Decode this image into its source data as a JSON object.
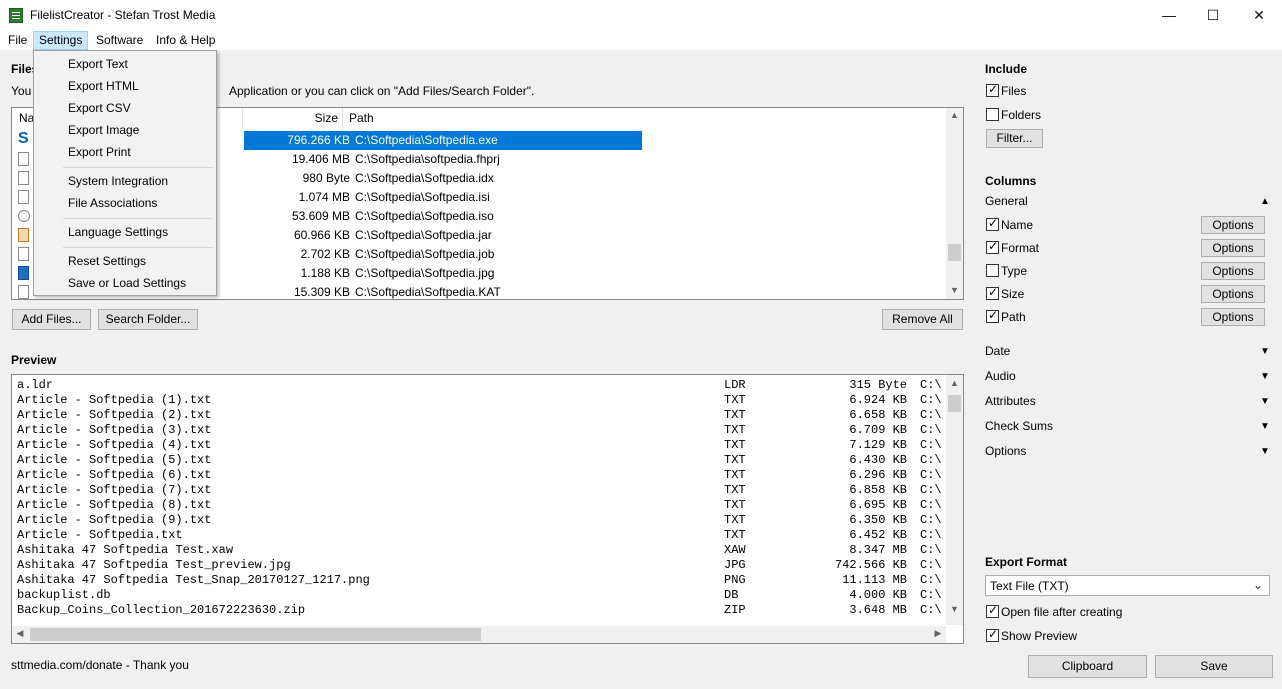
{
  "window": {
    "title": "FilelistCreator - Stefan Trost Media",
    "minimize": "—",
    "maximize": "☐",
    "close": "✕"
  },
  "menubar": [
    "File",
    "Settings",
    "Software",
    "Info & Help"
  ],
  "settings_menu": {
    "items": [
      "Export Text",
      "Export HTML",
      "Export CSV",
      "Export Image",
      "Export Print",
      "System Integration",
      "File Associations",
      "Language Settings",
      "Reset Settings",
      "Save or Load Settings"
    ]
  },
  "files_section": {
    "title": "Files",
    "hint_prefix": "You",
    "hint_suffix": "Application or you can click on \"Add Files/Search Folder\".",
    "columns": {
      "name": "Na",
      "size": "Size",
      "path": "Path"
    },
    "rows": [
      {
        "size": "796.266 KB",
        "path": "C:\\Softpedia\\Softpedia.exe",
        "selected": true
      },
      {
        "size": "19.406 MB",
        "path": "C:\\Softpedia\\softpedia.fhprj"
      },
      {
        "size": "980 Byte",
        "path": "C:\\Softpedia\\Softpedia.idx"
      },
      {
        "size": "1.074 MB",
        "path": "C:\\Softpedia\\Softpedia.isi"
      },
      {
        "size": "53.609 MB",
        "path": "C:\\Softpedia\\Softpedia.iso"
      },
      {
        "size": "60.966 KB",
        "path": "C:\\Softpedia\\Softpedia.jar"
      },
      {
        "size": "2.702 KB",
        "path": "C:\\Softpedia\\Softpedia.job"
      },
      {
        "size": "1.188 KB",
        "path": "C:\\Softpedia\\Softpedia.jpg"
      },
      {
        "size": "15.309 KB",
        "path": "C:\\Softpedia\\Softpedia.KAT"
      }
    ],
    "add_files": "Add Files...",
    "search_folder": "Search Folder...",
    "remove_all": "Remove All"
  },
  "preview": {
    "title": "Preview",
    "rows": [
      {
        "name": "a.ldr",
        "ext": "LDR",
        "size": "315 Byte",
        "path": "C:\\"
      },
      {
        "name": "Article - Softpedia (1).txt",
        "ext": "TXT",
        "size": "6.924 KB",
        "path": "C:\\"
      },
      {
        "name": "Article - Softpedia (2).txt",
        "ext": "TXT",
        "size": "6.658 KB",
        "path": "C:\\"
      },
      {
        "name": "Article - Softpedia (3).txt",
        "ext": "TXT",
        "size": "6.709 KB",
        "path": "C:\\"
      },
      {
        "name": "Article - Softpedia (4).txt",
        "ext": "TXT",
        "size": "7.129 KB",
        "path": "C:\\"
      },
      {
        "name": "Article - Softpedia (5).txt",
        "ext": "TXT",
        "size": "6.430 KB",
        "path": "C:\\"
      },
      {
        "name": "Article - Softpedia (6).txt",
        "ext": "TXT",
        "size": "6.296 KB",
        "path": "C:\\"
      },
      {
        "name": "Article - Softpedia (7).txt",
        "ext": "TXT",
        "size": "6.858 KB",
        "path": "C:\\"
      },
      {
        "name": "Article - Softpedia (8).txt",
        "ext": "TXT",
        "size": "6.695 KB",
        "path": "C:\\"
      },
      {
        "name": "Article - Softpedia (9).txt",
        "ext": "TXT",
        "size": "6.350 KB",
        "path": "C:\\"
      },
      {
        "name": "Article - Softpedia.txt",
        "ext": "TXT",
        "size": "6.452 KB",
        "path": "C:\\"
      },
      {
        "name": "Ashitaka 47 Softpedia Test.xaw",
        "ext": "XAW",
        "size": "8.347 MB",
        "path": "C:\\"
      },
      {
        "name": "Ashitaka 47 Softpedia Test_preview.jpg",
        "ext": "JPG",
        "size": "742.566 KB",
        "path": "C:\\"
      },
      {
        "name": "Ashitaka 47 Softpedia Test_Snap_20170127_1217.png",
        "ext": "PNG",
        "size": "11.113 MB",
        "path": "C:\\"
      },
      {
        "name": "backuplist.db",
        "ext": "DB",
        "size": "4.000 KB",
        "path": "C:\\"
      },
      {
        "name": "Backup_Coins_Collection_201672223630.zip",
        "ext": "ZIP",
        "size": "3.648 MB",
        "path": "C:\\"
      }
    ]
  },
  "status": "sttmedia.com/donate - Thank you",
  "include": {
    "title": "Include",
    "files": "Files",
    "folders": "Folders",
    "filter": "Filter..."
  },
  "columns": {
    "title": "Columns",
    "general": "General",
    "options_label": "Options",
    "items": [
      {
        "label": "Name",
        "checked": true
      },
      {
        "label": "Format",
        "checked": true
      },
      {
        "label": "Type",
        "checked": false
      },
      {
        "label": "Size",
        "checked": true
      },
      {
        "label": "Path",
        "checked": true
      }
    ],
    "groups": [
      "Date",
      "Audio",
      "Attributes",
      "Check Sums",
      "Options"
    ]
  },
  "export": {
    "title": "Export Format",
    "selected": "Text File (TXT)",
    "open_after": "Open file after creating",
    "show_preview": "Show Preview",
    "clipboard": "Clipboard",
    "save": "Save"
  },
  "colors": {
    "accent": "#0078d7",
    "menu_highlight": "#cce8ff"
  }
}
